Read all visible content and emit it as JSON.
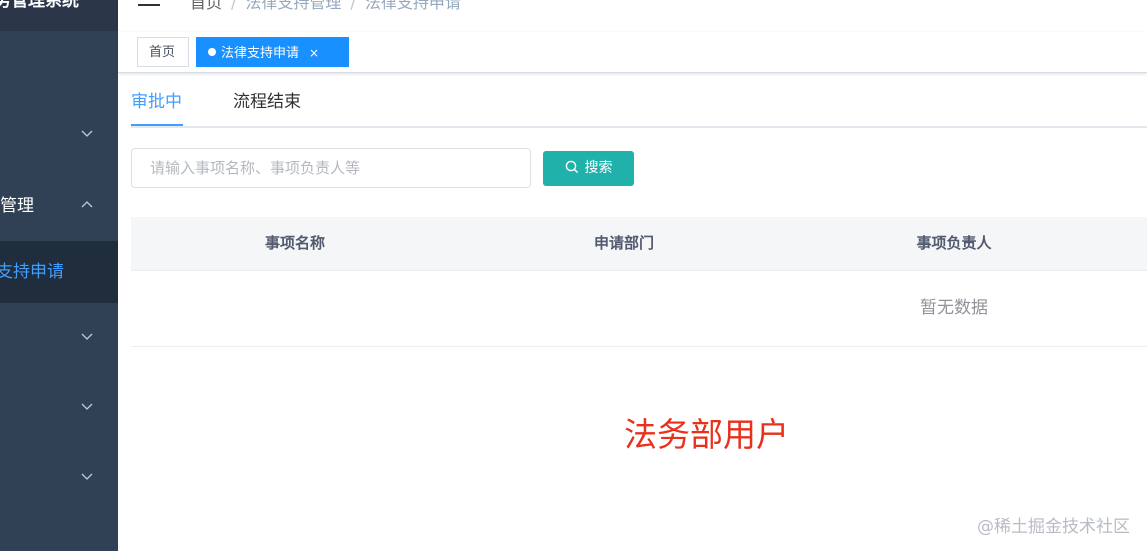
{
  "sidebar": {
    "title": "务管理系统",
    "items": [
      {
        "label": "",
        "expanded": false
      },
      {
        "label": "管理",
        "expanded": true
      },
      {
        "label": "支持申请",
        "active": true
      },
      {
        "label": "",
        "expanded": false
      },
      {
        "label": "",
        "expanded": false
      },
      {
        "label": "",
        "expanded": false
      }
    ]
  },
  "navbar": {
    "hamburger_icon": "menu-icon",
    "breadcrumb": [
      "首页",
      "法律支持管理",
      "法律支持申请"
    ],
    "separator": "/"
  },
  "tags": {
    "home": "首页",
    "active": "法律支持申请",
    "close": "×"
  },
  "tabs": [
    "审批中",
    "流程结束"
  ],
  "search": {
    "placeholder": "请输入事项名称、事项负责人等",
    "value": "",
    "button_label": "搜索"
  },
  "table": {
    "columns": [
      "事项名称",
      "申请部门",
      "事项负责人"
    ],
    "empty_text": "暂无数据"
  },
  "annotation": "法务部用户",
  "watermark": "@稀土掘金技术社区",
  "colors": {
    "sidebar_bg": "#304156",
    "accent": "#409eff",
    "tag_active": "#1890ff",
    "search_button": "#20b2aa",
    "annotation": "#e8301c"
  }
}
